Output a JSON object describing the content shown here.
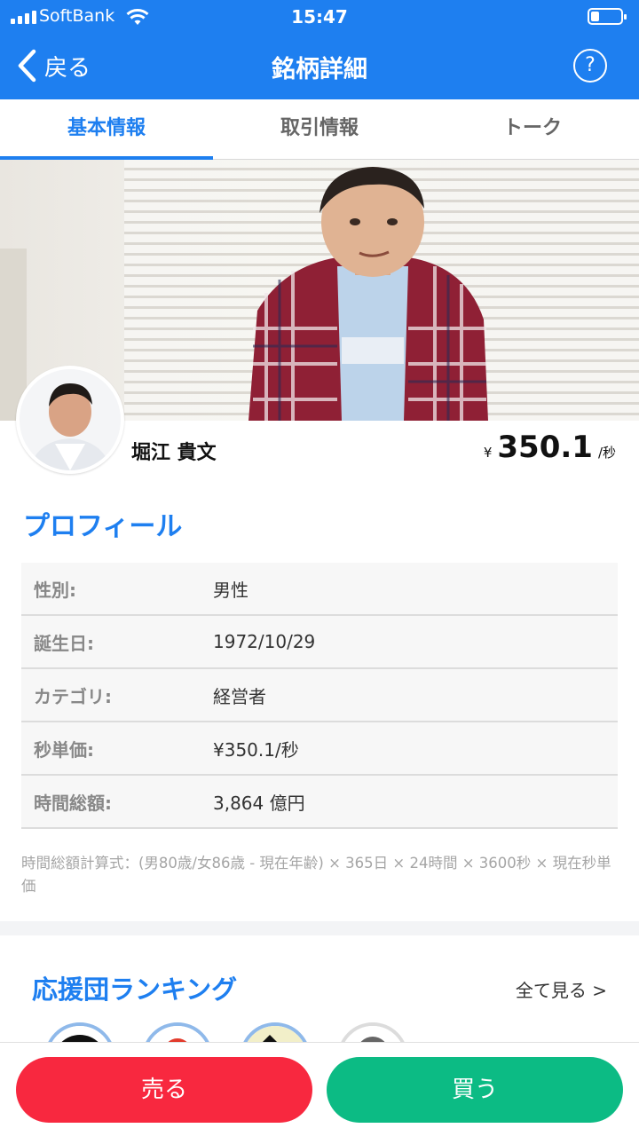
{
  "status_bar": {
    "carrier": "SoftBank",
    "time": "15:47",
    "battery_level": 0.25
  },
  "nav": {
    "back_label": "戻る",
    "title": "銘柄詳細",
    "help_symbol": "?"
  },
  "tabs": [
    {
      "label": "基本情報",
      "active": true
    },
    {
      "label": "取引情報",
      "active": false
    },
    {
      "label": "トーク",
      "active": false
    }
  ],
  "hero": {
    "name": "堀江 貴文",
    "price_currency": "¥",
    "price_value": "350.1",
    "price_unit": "/秒"
  },
  "profile": {
    "title": "プロフィール",
    "rows": [
      {
        "key": "性別:",
        "value": "男性"
      },
      {
        "key": "誕生日:",
        "value": "1972/10/29"
      },
      {
        "key": "カテゴリ:",
        "value": "経営者"
      },
      {
        "key": "秒単価:",
        "value": "¥350.1/秒"
      },
      {
        "key": "時間総額:",
        "value": "3,864 億円"
      }
    ],
    "formula": "時間総額計算式：(男80歳/女86歳 - 現在年齢) × 365日 × 24時間 × 3600秒 × 現在秒単価"
  },
  "ranking": {
    "title": "応援団ランキング",
    "see_all": "全て見る >"
  },
  "actions": {
    "sell": "売る",
    "buy": "買う"
  },
  "colors": {
    "brand_blue": "#1e7ff0",
    "sell_red": "#f8283f",
    "buy_green": "#0cbb84"
  }
}
